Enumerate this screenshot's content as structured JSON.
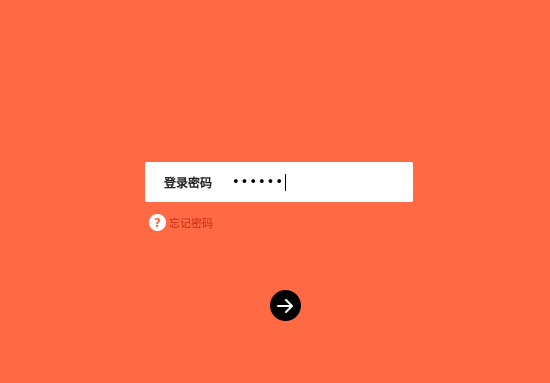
{
  "login": {
    "password_label": "登录密码",
    "password_value": "••••••",
    "forgot_label": "忘记密码",
    "help_glyph": "?"
  },
  "icons": {
    "help": "question-circle-icon",
    "submit": "arrow-right-icon"
  },
  "colors": {
    "background": "#FF6A45",
    "input_bg": "#FFFFFF",
    "link": "#C62A12",
    "button": "#000000"
  }
}
